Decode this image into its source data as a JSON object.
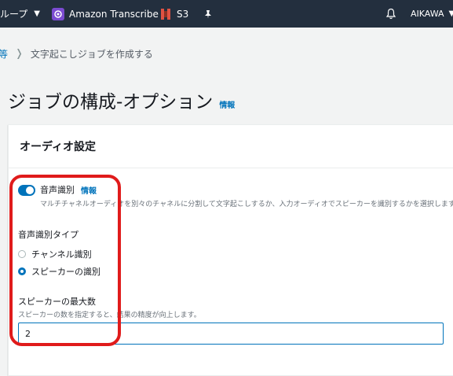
{
  "topbar": {
    "groups_label": "ループ",
    "transcribe_label": "Amazon Transcribe",
    "s3_label": "S3",
    "user_label": "AIKAWA",
    "icons": [
      "chevron-down-icon",
      "transcribe-icon",
      "s3-icon",
      "pin-icon",
      "bell-icon"
    ]
  },
  "breadcrumb": {
    "prev": "等",
    "current": "文字起こしジョブを作成する"
  },
  "page": {
    "title": "ジョブの構成-オプション",
    "info": "情報"
  },
  "audio_settings": {
    "title": "オーディオ設定",
    "speaker_id": {
      "label": "音声識別",
      "info": "情報",
      "description": "マルチチャネルオーディオを別々のチャネルに分割して文字起こしするか、入力オーディオでスピーカーを識別するかを選択します。",
      "enabled": true
    },
    "type_label": "音声識別タイプ",
    "options": [
      {
        "label": "チャンネル識別",
        "selected": false
      },
      {
        "label": "スピーカーの識別",
        "selected": true
      }
    ],
    "max_speakers": {
      "label": "スピーカーの最大数",
      "description": "スピーカーの数を指定すると、結果の精度が向上します。",
      "value": "2"
    }
  },
  "colors": {
    "topbar": "#232f3e",
    "link": "#0073bb",
    "annotation": "#e01b1b"
  }
}
